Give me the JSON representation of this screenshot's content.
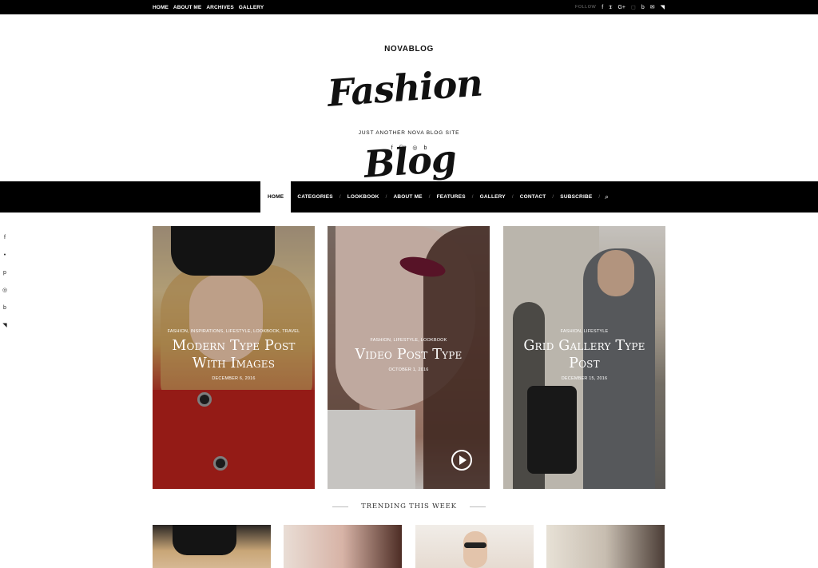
{
  "topbar": {
    "links": [
      "HOME",
      "ABOUT ME",
      "ARCHIVES",
      "GALLERY"
    ],
    "follow_label": "FOLLOW",
    "social_icons": [
      "facebook-icon",
      "twitter-icon",
      "google-plus-icon",
      "instagram-icon",
      "bloglovin-icon",
      "email-icon",
      "rss-icon"
    ]
  },
  "header": {
    "brand": "NOVABLOG",
    "logo_text": "Fashion Blog",
    "tagline": "JUST ANOTHER NOVA BLOG SITE",
    "social_icons": [
      "facebook-icon",
      "twitter-icon",
      "instagram-icon",
      "bloglovin-icon"
    ]
  },
  "nav": {
    "items": [
      "HOME",
      "CATEGORIES",
      "LOOKBOOK",
      "ABOUT ME",
      "FEATURES",
      "GALLERY",
      "CONTACT",
      "SUBSCRIBE"
    ],
    "active": "HOME"
  },
  "side_social": [
    "facebook-icon",
    "twitter-icon",
    "pinterest-icon",
    "instagram-icon",
    "bloglovin-icon",
    "rss-icon"
  ],
  "featured": [
    {
      "cats": "FASHION, INSPIRATIONS, LIFESTYLE, LOOKBOOK, TRAVEL",
      "title": "Modern Type Post With Images",
      "date": "DECEMBER 6, 2016"
    },
    {
      "cats": "FASHION, LIFESTYLE, LOOKBOOK",
      "title": "Video Post Type",
      "date": "OCTOBER 1, 2016"
    },
    {
      "cats": "FASHION, LIFESTYLE",
      "title": "Grid Gallery Type Post",
      "date": "DECEMBER 15, 2016"
    }
  ],
  "trending": {
    "label": "TRENDING THIS WEEK"
  },
  "colors": {
    "bar": "#000000",
    "text": "#111111",
    "background": "#ffffff"
  }
}
